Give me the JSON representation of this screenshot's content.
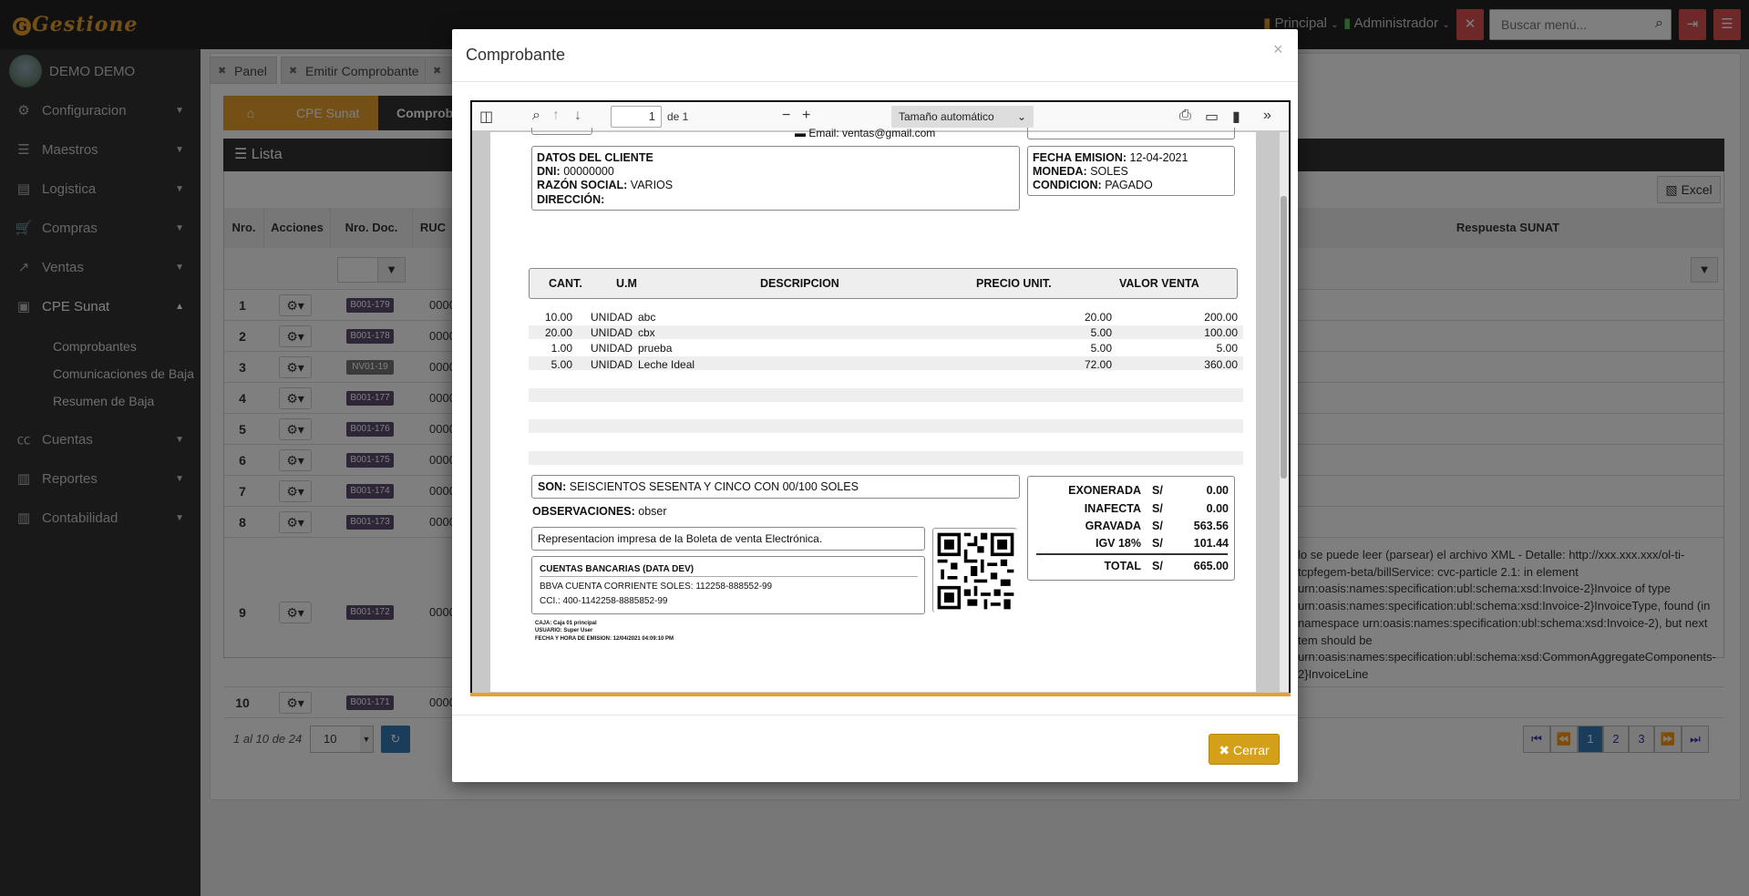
{
  "app": {
    "logo": "Gestione"
  },
  "topbar": {
    "principal": "Principal",
    "admin": "Administrador",
    "search_placeholder": "Buscar menú..."
  },
  "sidebar": {
    "user": "DEMO DEMO",
    "items": [
      {
        "label": "Configuracion",
        "icon": "gears-icon"
      },
      {
        "label": "Maestros",
        "icon": "list-icon"
      },
      {
        "label": "Logistica",
        "icon": "building-icon"
      },
      {
        "label": "Compras",
        "icon": "cart-icon"
      },
      {
        "label": "Ventas",
        "icon": "chart-line-icon"
      },
      {
        "label": "CPE Sunat",
        "icon": "word-file-icon"
      },
      {
        "label": "Cuentas",
        "icon": "cc-icon"
      },
      {
        "label": "Reportes",
        "icon": "book-icon"
      },
      {
        "label": "Contabilidad",
        "icon": "book-icon"
      }
    ],
    "sub": [
      "Comprobantes",
      "Comunicaciones de Baja",
      "Resumen de Baja"
    ]
  },
  "tabs": [
    "Panel",
    "Emitir Comprobante"
  ],
  "breadcrumb": {
    "home": "⌂",
    "cpe": "CPE Sunat",
    "current": "Comprob"
  },
  "panel": {
    "title": "Lista",
    "excel": "Excel",
    "headers": {
      "nro": "Nro.",
      "acciones": "Acciones",
      "nrodoc": "Nro. Doc.",
      "ruc": "RUC",
      "respuesta": "Respuesta SUNAT"
    },
    "rows": [
      {
        "n": "1",
        "doc": "B001-179",
        "ruc": "0000"
      },
      {
        "n": "2",
        "doc": "B001-178",
        "ruc": "0000"
      },
      {
        "n": "3",
        "doc": "NV01-19",
        "ruc": "0000"
      },
      {
        "n": "4",
        "doc": "B001-177",
        "ruc": "0000"
      },
      {
        "n": "5",
        "doc": "B001-176",
        "ruc": "0000"
      },
      {
        "n": "6",
        "doc": "B001-175",
        "ruc": "0000"
      },
      {
        "n": "7",
        "doc": "B001-174",
        "ruc": "0000"
      },
      {
        "n": "8",
        "doc": "B001-173",
        "ruc": "0000"
      },
      {
        "n": "9",
        "doc": "B001-172",
        "ruc": "0000"
      },
      {
        "n": "10",
        "doc": "B001-171",
        "ruc": "0000"
      }
    ],
    "error_lines": [
      "lo se puede leer (parsear) el archivo XML - Detalle: http://xxx.xxx.xxx/ol-ti-",
      "tcpfegem-beta/billService: cvc-particle 2.1: in element",
      "urn:oasis:names:specification:ubl:schema:xsd:Invoice-2}Invoice of type",
      "urn:oasis:names:specification:ubl:schema:xsd:Invoice-2}InvoiceType, found (in",
      "namespace urn:oasis:names:specification:ubl:schema:xsd:Invoice-2), but next",
      "tem should be",
      "urn:oasis:names:specification:ubl:schema:xsd:CommonAggregateComponents-",
      "2}InvoiceLine"
    ],
    "pager_info": "1 al 10 de 24",
    "page_size": "10",
    "pages": [
      "1",
      "2",
      "3"
    ]
  },
  "modal": {
    "title": "Comprobante",
    "close_x": "×",
    "button": "Cerrar",
    "viewer": {
      "page": "1",
      "of": "de 1",
      "zoom": "Tamaño automático"
    }
  },
  "receipt": {
    "email": "Email: ventas@gmail.com",
    "cliente_head": "DATOS DEL CLIENTE",
    "dni_l": "DNI:",
    "dni": "00000000",
    "razon_l": "RAZÓN SOCIAL:",
    "razon": "VARIOS",
    "dir_l": "DIRECCIÓN:",
    "fecha_l": "FECHA EMISION:",
    "fecha": "12-04-2021",
    "moneda_l": "MONEDA:",
    "moneda": "SOLES",
    "cond_l": "CONDICION:",
    "cond": "PAGADO",
    "cols": {
      "cant": "CANT.",
      "um": "U.M",
      "desc": "DESCRIPCION",
      "precio": "PRECIO UNIT.",
      "valor": "VALOR VENTA"
    },
    "items": [
      {
        "cant": "10.00",
        "um": "UNIDAD",
        "desc": "abc",
        "precio": "20.00",
        "valor": "200.00"
      },
      {
        "cant": "20.00",
        "um": "UNIDAD",
        "desc": "cbx",
        "precio": "5.00",
        "valor": "100.00"
      },
      {
        "cant": "1.00",
        "um": "UNIDAD",
        "desc": "prueba",
        "precio": "5.00",
        "valor": "5.00"
      },
      {
        "cant": "5.00",
        "um": "UNIDAD",
        "desc": "Leche Ideal",
        "precio": "72.00",
        "valor": "360.00"
      }
    ],
    "son_l": "SON:",
    "son": "SEISCIENTOS SESENTA Y CINCO CON 00/100 SOLES",
    "obs_l": "OBSERVACIONES:",
    "obs": "obser",
    "repr": "Representacion impresa de la Boleta de venta Electrónica.",
    "bank_head": "CUENTAS BANCARIAS (DATA DEV)",
    "bank1": "BBVA CUENTA CORRIENTE SOLES: 112258-888552-99",
    "bank2": "CCI.: 400-1142258-8885852-99",
    "caja": "CAJA: Caja 01 principal",
    "usuario": "USUARIO: Super User",
    "fechahora": "FECHA Y HORA DE EMISION: 12/04/2021 04:09:10 PM",
    "totals": [
      {
        "l": "EXONERADA",
        "c": "S/",
        "v": "0.00"
      },
      {
        "l": "INAFECTA",
        "c": "S/",
        "v": "0.00"
      },
      {
        "l": "GRAVADA",
        "c": "S/",
        "v": "563.56"
      },
      {
        "l": "IGV 18%",
        "c": "S/",
        "v": "101.44"
      },
      {
        "l": "TOTAL",
        "c": "S/",
        "v": "665.00"
      }
    ]
  }
}
